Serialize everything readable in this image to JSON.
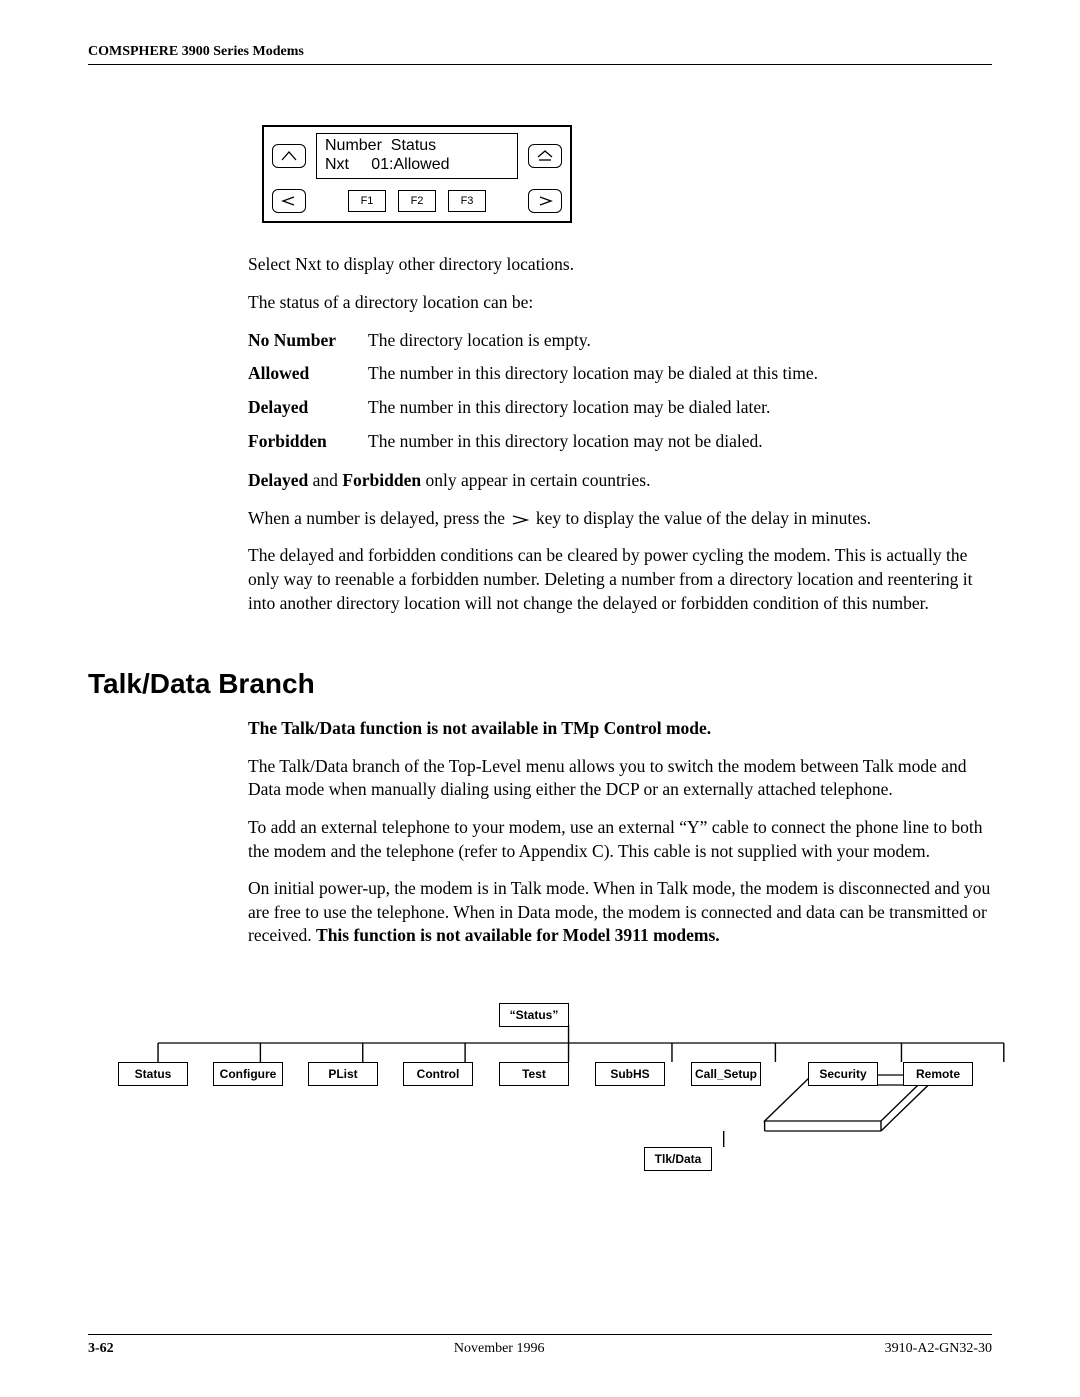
{
  "running_head": "COMSPHERE 3900 Series Modems",
  "lcd": {
    "line1": "Number  Status",
    "line2": "Nxt     01:Allowed",
    "f1": "F1",
    "f2": "F2",
    "f3": "F3"
  },
  "p_select_nxt": "Select Nxt to display other directory locations.",
  "p_status_intro": "The status of a directory location can be:",
  "status_defs": [
    {
      "term": "No Number",
      "desc": "The directory location is empty."
    },
    {
      "term": "Allowed",
      "desc": "The number in this directory location may be dialed at this time."
    },
    {
      "term": "Delayed",
      "desc": "The number in this directory location may be dialed later."
    },
    {
      "term": "Forbidden",
      "desc": "The number in this directory location may not be dialed."
    }
  ],
  "p_countries_b1": "Delayed",
  "p_countries_mid": " and ",
  "p_countries_b2": "Forbidden",
  "p_countries_tail": " only appear in certain countries.",
  "p_delay_a": "When a number is delayed, press the ",
  "p_delay_b": " key to display the value of the delay in minutes.",
  "p_clear": "The delayed and forbidden conditions can be cleared by power cycling the modem. This is actually the only way to reenable a forbidden number. Deleting a number from a directory location and reentering it into another directory location will not change the delayed or forbidden condition of this number.",
  "section_title": "Talk/Data Branch",
  "p_tmp": "The Talk/Data function is not available in TMp Control mode.",
  "p_branch": "The Talk/Data branch of the Top-Level menu allows you to switch the modem between Talk mode and Data mode when manually dialing using either the DCP or an externally attached telephone.",
  "p_ycable": "To add an external telephone to your modem, use an external “Y” cable to connect the phone line to both the modem and the telephone (refer to Appendix C). This cable is not supplied with your modem.",
  "p_initial_a": "On initial power-up, the modem is in Talk mode. When in Talk mode, the modem is disconnected and you are free to use the telephone. When in Data mode, the modem is connected and data can be transmitted or received. ",
  "p_initial_b": "This function is not available for Model 3911 modems.",
  "tree": {
    "top": "“Status”",
    "row": [
      "Status",
      "Configure",
      "PList",
      "Control",
      "Test",
      "SubHS",
      "Call_Setup",
      "Security",
      "Remote"
    ],
    "data": "Tlk/Data"
  },
  "footer": {
    "page": "3-62",
    "date": "November 1996",
    "doc": "3910-A2-GN32-30"
  }
}
